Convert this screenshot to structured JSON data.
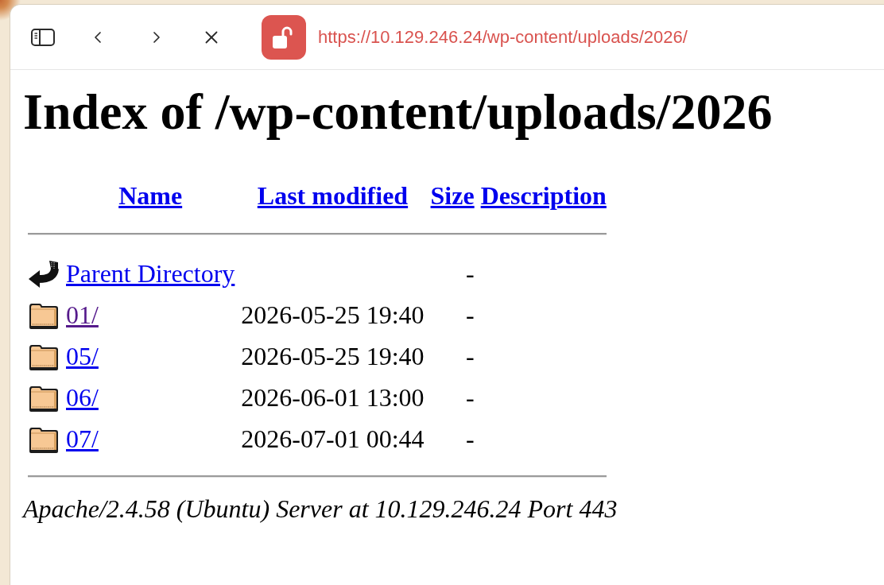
{
  "toolbar": {
    "not_secure": true,
    "url": "https://10.129.246.24/wp-content/uploads/2026/"
  },
  "page": {
    "heading": "Index of /wp-content/uploads/2026",
    "table": {
      "columns": [
        "Name",
        "Last modified",
        "Size",
        "Description"
      ],
      "rows": [
        {
          "kind": "parent",
          "name": "Parent Directory",
          "size": "-",
          "visited": false
        },
        {
          "kind": "folder",
          "name": "01/",
          "last_modified": "2026-05-25 19:40",
          "size": "-",
          "visited": true
        },
        {
          "kind": "folder",
          "name": "05/",
          "last_modified": "2026-05-25 19:40",
          "size": "-",
          "visited": false
        },
        {
          "kind": "folder",
          "name": "06/",
          "last_modified": "2026-06-01 13:00",
          "size": "-",
          "visited": false
        },
        {
          "kind": "folder",
          "name": "07/",
          "last_modified": "2026-07-01 00:44",
          "size": "-",
          "visited": false
        }
      ]
    },
    "footer": "Apache/2.4.58 (Ubuntu) Server at 10.129.246.24 Port 443"
  }
}
